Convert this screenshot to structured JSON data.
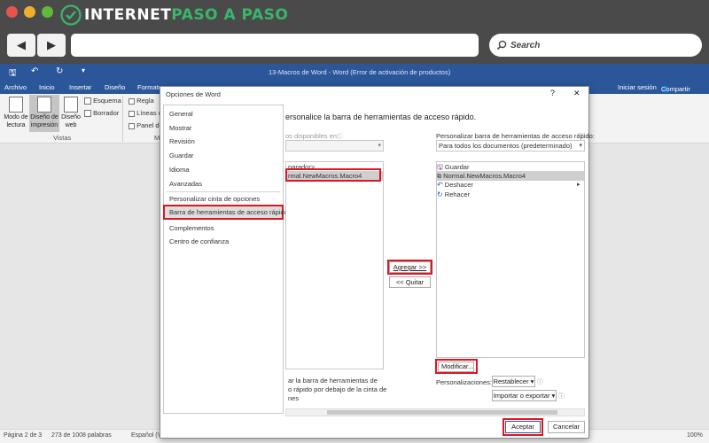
{
  "browser": {
    "logo_text_1": "INTERNET",
    "logo_text_2": "PASO A PASO",
    "search_label": "Search",
    "colors": {
      "close": "#e6544f",
      "min": "#f0b02e",
      "max": "#5fba3a",
      "logo_green": "#3bb56b",
      "logo_white": "#ffffff"
    }
  },
  "word": {
    "title": "13-Macros de Word - Word (Error de activación de productos)",
    "tabs": [
      "Archivo",
      "Inicio",
      "Insertar",
      "Diseño",
      "Formato"
    ],
    "signin": "Iniciar sesión",
    "share": "Compartir",
    "ribbon": {
      "read_mode": "Modo de lectura",
      "print_layout": "Diseño de impresión",
      "web_layout": "Diseño web",
      "outline": "Esquema",
      "draft": "Borrador",
      "ruler": "Regla",
      "gridlines": "Líneas de",
      "nav_pane": "Panel de",
      "group_views": "Vistas",
      "group_m": "M"
    },
    "status": {
      "page": "Página 2 de 3",
      "words": "273 de 1008 palabras",
      "lang": "Español (Venezuela)",
      "zoom": "100%"
    }
  },
  "dialog": {
    "title": "Opciones de Word",
    "help": "?",
    "close": "✕",
    "categories": [
      "General",
      "Mostrar",
      "Revisión",
      "Guardar",
      "Idioma",
      "Avanzadas",
      "Personalizar cinta de opciones",
      "Barra de herramientas de acceso rápido",
      "Complementos",
      "Centro de confianza"
    ],
    "selected_category_index": 7,
    "heading": "ersonalice la barra de herramientas de acceso rápido.",
    "choose_from_label": "os disponibles en:",
    "left_list": {
      "separator": "parador>",
      "item": "rmal.NewMacros.Macro4"
    },
    "add_button": "Agregar >>",
    "remove_button": "<< Quitar",
    "left_bottom_text": [
      "ar la barra de herramientas de",
      "o rápido por debajo de la cinta de",
      "nes"
    ],
    "customize_label": "Personalizar barra de herramientas de acceso rápido:",
    "customize_value": "Para todos los documentos (predeterminado)",
    "qat_items": [
      {
        "label": "Guardar",
        "icon": "save-icon"
      },
      {
        "label": "Normal.NewMacros.Macro4",
        "icon": "macro-icon"
      },
      {
        "label": "Deshacer",
        "icon": "undo-icon"
      },
      {
        "label": "Rehacer",
        "icon": "redo-icon"
      }
    ],
    "modify_button": "Modificar...",
    "customizations_label": "Personalizaciones:",
    "reset_button": "Restablecer ▾",
    "import_export_button": "Importar o exportar ▾",
    "ok_button": "Aceptar",
    "cancel_button": "Cancelar"
  }
}
